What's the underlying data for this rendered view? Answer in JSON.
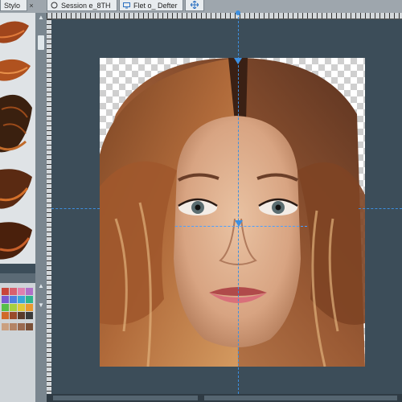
{
  "tabs": [
    {
      "label": "Stylo",
      "icon": "tab-icon"
    },
    {
      "label": "Session e_8TH",
      "icon": "circle-icon"
    },
    {
      "label": "Flet o_ Defter",
      "icon": "monitor-icon"
    },
    {
      "label": "",
      "icon": "move-icon"
    }
  ],
  "close_glyph": "×",
  "colors": {
    "workspace": "#3c4d59",
    "guide": "#3d8fe0",
    "tab_bg": "#e8ecef"
  },
  "brushes": [
    "hair-brush-1",
    "hair-brush-2",
    "hair-brush-3",
    "hair-brush-4",
    "hair-brush-5"
  ],
  "swatch_colors": [
    "#c8453a",
    "#d8606e",
    "#e080b0",
    "#b070c8",
    "#7a5ad0",
    "#4f7fe0",
    "#39a6d8",
    "#2fb58c",
    "#58c048",
    "#a8d040",
    "#e0c838",
    "#e89a30",
    "#d06a2a",
    "#9a4a2a",
    "#5a3a2a",
    "#3a3a3a"
  ]
}
